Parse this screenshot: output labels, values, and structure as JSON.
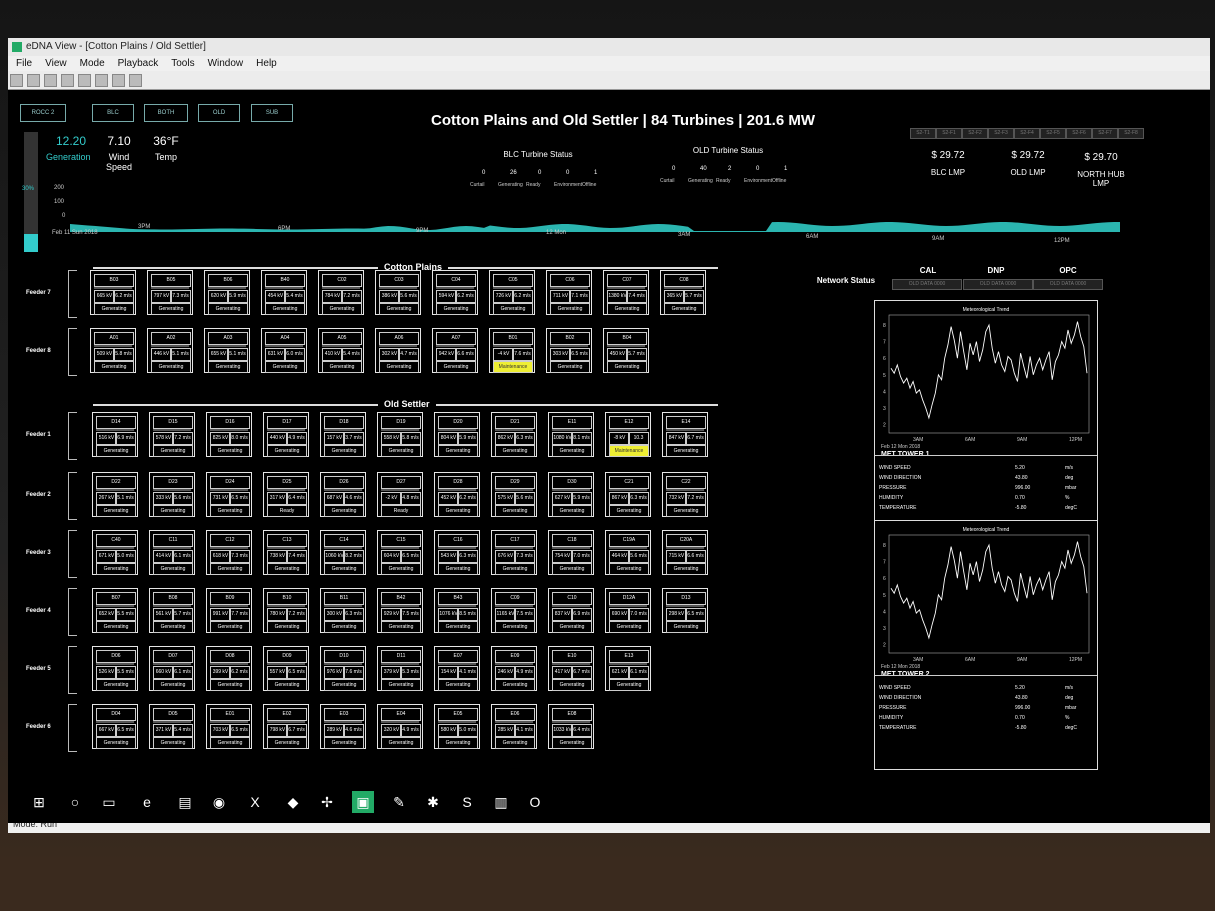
{
  "window": {
    "title": "eDNA View - [Cotton Plains / Old Settler]"
  },
  "menu": [
    "File",
    "View",
    "Mode",
    "Playback",
    "Tools",
    "Window",
    "Help"
  ],
  "statusbar": {
    "mode": "Mode: Run"
  },
  "nav": [
    "ROCC 2",
    "BLC",
    "BOTH",
    "OLD",
    "SUB"
  ],
  "header": {
    "title": "Cotton Plains and Old Settler | 84 Turbines | 201.6 MW",
    "generation": {
      "value": "12.20",
      "label": "Generation"
    },
    "wind": {
      "value": "7.10",
      "label": "Wind Speed"
    },
    "temp": {
      "value": "36°F",
      "label": "Temp"
    },
    "gauge_pct": "30%",
    "gauge_ticks": [
      "200",
      "100",
      "0"
    ],
    "gauge_fill_fraction": 0.15
  },
  "blc_status": {
    "title": "BLC Turbine Status",
    "counts": [
      "0",
      "26",
      "0",
      "0",
      "1"
    ],
    "labels": [
      "Curtail",
      "Generating",
      "Ready",
      "Environment",
      "Offline"
    ]
  },
  "old_status": {
    "title": "OLD Turbine Status",
    "counts": [
      "0",
      "40",
      "2",
      "0",
      "1"
    ],
    "labels": [
      "Curtail",
      "Generating",
      "Ready",
      "Environment",
      "Offline"
    ]
  },
  "lmp": {
    "tabs": [
      "S2-T1",
      "S2-F1",
      "S2-F2",
      "S2-F3",
      "S2-F4",
      "S2-F5",
      "S2-F6",
      "S2-F7",
      "S2-F8"
    ],
    "values": [
      {
        "price": "$ 29.72",
        "label": "BLC LMP"
      },
      {
        "price": "$ 29.72",
        "label": "OLD LMP"
      },
      {
        "price": "$ 29.70",
        "label": "NORTH HUB LMP"
      }
    ]
  },
  "timeline": {
    "ticks": [
      "3PM",
      "6PM",
      "9PM",
      "12 Mon",
      "3AM",
      "6AM",
      "9AM",
      "12PM"
    ],
    "date": "Feb 11 Sun 2018"
  },
  "sections": {
    "cotton": "Cotton Plains",
    "old": "Old Settler"
  },
  "network": {
    "label": "Network Status",
    "sites": [
      "CAL",
      "DNP",
      "OPC"
    ],
    "sub": [
      "OLD DATA 0000",
      "OLD DATA 0000",
      "OLD DATA 0000"
    ]
  },
  "feeders": [
    {
      "name": "Feeder 7",
      "turbines": [
        {
          "id": "B03",
          "kv": "665 kV",
          "ms": "6.2 m/s",
          "status": "Generating"
        },
        {
          "id": "B05",
          "kv": "797 kV",
          "ms": "7.3 m/s",
          "status": "Generating"
        },
        {
          "id": "B06",
          "kv": "620 kV",
          "ms": "5.9 m/s",
          "status": "Generating"
        },
        {
          "id": "B40",
          "kv": "454 kV",
          "ms": "5.4 m/s",
          "status": "Generating"
        },
        {
          "id": "C02",
          "kv": "784 kV",
          "ms": "7.2 m/s",
          "status": "Generating"
        },
        {
          "id": "C03",
          "kv": "386 kV",
          "ms": "5.6 m/s",
          "status": "Generating"
        },
        {
          "id": "C04",
          "kv": "594 kV",
          "ms": "6.2 m/s",
          "status": "Generating"
        },
        {
          "id": "C05",
          "kv": "726 kV",
          "ms": "6.2 m/s",
          "status": "Generating"
        },
        {
          "id": "C06",
          "kv": "711 kV",
          "ms": "7.1 m/s",
          "status": "Generating"
        },
        {
          "id": "C07",
          "kv": "1380 kV",
          "ms": "7.4 m/s",
          "status": "Generating"
        },
        {
          "id": "C08",
          "kv": "365 kV",
          "ms": "5.7 m/s",
          "status": "Generating"
        }
      ]
    },
    {
      "name": "Feeder 8",
      "turbines": [
        {
          "id": "A01",
          "kv": "509 kV",
          "ms": "5.8 m/s",
          "status": "Generating"
        },
        {
          "id": "A02",
          "kv": "446 kV",
          "ms": "5.1 m/s",
          "status": "Generating"
        },
        {
          "id": "A03",
          "kv": "655 kV",
          "ms": "5.1 m/s",
          "status": "Generating"
        },
        {
          "id": "A04",
          "kv": "631 kV",
          "ms": "6.0 m/s",
          "status": "Generating"
        },
        {
          "id": "A05",
          "kv": "410 kV",
          "ms": "5.4 m/s",
          "status": "Generating"
        },
        {
          "id": "A06",
          "kv": "302 kV",
          "ms": "4.7 m/s",
          "status": "Generating"
        },
        {
          "id": "A07",
          "kv": "942 kV",
          "ms": "6.6 m/s",
          "status": "Generating"
        },
        {
          "id": "B01",
          "kv": "-4 kV",
          "ms": "7.6 m/s",
          "status": "Maintenance"
        },
        {
          "id": "B02",
          "kv": "303 kV",
          "ms": "6.5 m/s",
          "status": "Generating"
        },
        {
          "id": "B04",
          "kv": "450 kV",
          "ms": "5.7 m/s",
          "status": "Generating"
        }
      ]
    },
    {
      "name": "Feeder 1",
      "turbines": [
        {
          "id": "D14",
          "kv": "516 kV",
          "ms": "6.9 m/s",
          "status": "Generating"
        },
        {
          "id": "D15",
          "kv": "578 kV",
          "ms": "7.2 m/s",
          "status": "Generating"
        },
        {
          "id": "D16",
          "kv": "825 kV",
          "ms": "8.0 m/s",
          "status": "Generating"
        },
        {
          "id": "D17",
          "kv": "440 kV",
          "ms": "4.9 m/s",
          "status": "Generating"
        },
        {
          "id": "D18",
          "kv": "157 kV",
          "ms": "3.7 m/s",
          "status": "Generating"
        },
        {
          "id": "D19",
          "kv": "558 kV",
          "ms": "5.8 m/s",
          "status": "Generating"
        },
        {
          "id": "D20",
          "kv": "804 kV",
          "ms": "5.9 m/s",
          "status": "Generating"
        },
        {
          "id": "D21",
          "kv": "862 kV",
          "ms": "6.3 m/s",
          "status": "Generating"
        },
        {
          "id": "E11",
          "kv": "1080 kV",
          "ms": "8.1 m/s",
          "status": "Generating"
        },
        {
          "id": "E12",
          "kv": "-8 kV",
          "ms": "10.3 m/s",
          "status": "Maintenance"
        },
        {
          "id": "E14",
          "kv": "847 kV",
          "ms": "6.7 m/s",
          "status": "Generating"
        }
      ]
    },
    {
      "name": "Feeder 2",
      "turbines": [
        {
          "id": "D22",
          "kv": "267 kV",
          "ms": "5.1 m/s",
          "status": "Generating"
        },
        {
          "id": "D23",
          "kv": "333 kV",
          "ms": "5.6 m/s",
          "status": "Generating"
        },
        {
          "id": "D24",
          "kv": "731 kV",
          "ms": "6.5 m/s",
          "status": "Generating"
        },
        {
          "id": "D25",
          "kv": "317 kV",
          "ms": "6.4 m/s",
          "status": "Ready"
        },
        {
          "id": "D26",
          "kv": "687 kV",
          "ms": "4.6 m/s",
          "status": "Generating"
        },
        {
          "id": "D27",
          "kv": "-2 kV",
          "ms": "4.8 m/s",
          "status": "Ready"
        },
        {
          "id": "D28",
          "kv": "452 kV",
          "ms": "6.2 m/s",
          "status": "Generating"
        },
        {
          "id": "D29",
          "kv": "575 kV",
          "ms": "5.6 m/s",
          "status": "Generating"
        },
        {
          "id": "D30",
          "kv": "627 kV",
          "ms": "5.9 m/s",
          "status": "Generating"
        },
        {
          "id": "C21",
          "kv": "867 kV",
          "ms": "6.3 m/s",
          "status": "Generating"
        },
        {
          "id": "C22",
          "kv": "732 kV",
          "ms": "7.2 m/s",
          "status": "Generating"
        }
      ]
    },
    {
      "name": "Feeder 3",
      "turbines": [
        {
          "id": "C40",
          "kv": "671 kV",
          "ms": "5.0 m/s",
          "status": "Generating"
        },
        {
          "id": "C11",
          "kv": "414 kV",
          "ms": "6.1 m/s",
          "status": "Generating"
        },
        {
          "id": "C12",
          "kv": "618 kV",
          "ms": "7.3 m/s",
          "status": "Generating"
        },
        {
          "id": "C13",
          "kv": "738 kV",
          "ms": "7.4 m/s",
          "status": "Generating"
        },
        {
          "id": "C14",
          "kv": "1060 kV",
          "ms": "8.2 m/s",
          "status": "Generating"
        },
        {
          "id": "C15",
          "kv": "604 kV",
          "ms": "6.5 m/s",
          "status": "Generating"
        },
        {
          "id": "C16",
          "kv": "543 kV",
          "ms": "6.3 m/s",
          "status": "Generating"
        },
        {
          "id": "C17",
          "kv": "676 kV",
          "ms": "7.3 m/s",
          "status": "Generating"
        },
        {
          "id": "C18",
          "kv": "754 kV",
          "ms": "7.0 m/s",
          "status": "Generating"
        },
        {
          "id": "C19A",
          "kv": "464 kV",
          "ms": "5.6 m/s",
          "status": "Generating"
        },
        {
          "id": "C20A",
          "kv": "715 kV",
          "ms": "6.6 m/s",
          "status": "Generating"
        }
      ]
    },
    {
      "name": "Feeder 4",
      "turbines": [
        {
          "id": "B07",
          "kv": "652 kV",
          "ms": "5.5 m/s",
          "status": "Generating"
        },
        {
          "id": "B08",
          "kv": "561 kV",
          "ms": "5.7 m/s",
          "status": "Generating"
        },
        {
          "id": "B09",
          "kv": "991 kV",
          "ms": "7.7 m/s",
          "status": "Generating"
        },
        {
          "id": "B10",
          "kv": "780 kV",
          "ms": "7.2 m/s",
          "status": "Generating"
        },
        {
          "id": "B11",
          "kv": "300 kV",
          "ms": "6.3 m/s",
          "status": "Generating"
        },
        {
          "id": "B42",
          "kv": "929 kV",
          "ms": "7.5 m/s",
          "status": "Generating"
        },
        {
          "id": "B43",
          "kv": "1076 kV",
          "ms": "8.5 m/s",
          "status": "Generating"
        },
        {
          "id": "C09",
          "kv": "1165 kV",
          "ms": "7.5 m/s",
          "status": "Generating"
        },
        {
          "id": "C10",
          "kv": "837 kV",
          "ms": "6.9 m/s",
          "status": "Generating"
        },
        {
          "id": "D12A",
          "kv": "690 kV",
          "ms": "7.0 m/s",
          "status": "Generating"
        },
        {
          "id": "D13",
          "kv": "298 kV",
          "ms": "6.5 m/s",
          "status": "Generating"
        }
      ]
    },
    {
      "name": "Feeder 5",
      "turbines": [
        {
          "id": "D06",
          "kv": "526 kV",
          "ms": "5.5 m/s",
          "status": "Generating"
        },
        {
          "id": "D07",
          "kv": "660 kV",
          "ms": "6.1 m/s",
          "status": "Generating"
        },
        {
          "id": "D08",
          "kv": "399 kV",
          "ms": "6.2 m/s",
          "status": "Generating"
        },
        {
          "id": "D09",
          "kv": "557 kV",
          "ms": "6.5 m/s",
          "status": "Generating"
        },
        {
          "id": "D10",
          "kv": "976 kV",
          "ms": "7.6 m/s",
          "status": "Generating"
        },
        {
          "id": "D11",
          "kv": "379 kV",
          "ms": "5.3 m/s",
          "status": "Generating"
        },
        {
          "id": "E07",
          "kv": "154 kV",
          "ms": "4.1 m/s",
          "status": "Generating"
        },
        {
          "id": "E09",
          "kv": "246 kV",
          "ms": "4.9 m/s",
          "status": "Generating"
        },
        {
          "id": "E10",
          "kv": "417 kV",
          "ms": "6.7 m/s",
          "status": "Generating"
        },
        {
          "id": "E13",
          "kv": "621 kV",
          "ms": "6.1 m/s",
          "status": "Generating"
        }
      ]
    },
    {
      "name": "Feeder 6",
      "turbines": [
        {
          "id": "D04",
          "kv": "667 kV",
          "ms": "6.5 m/s",
          "status": "Generating"
        },
        {
          "id": "D05",
          "kv": "371 kV",
          "ms": "5.4 m/s",
          "status": "Generating"
        },
        {
          "id": "E01",
          "kv": "703 kV",
          "ms": "6.5 m/s",
          "status": "Generating"
        },
        {
          "id": "E02",
          "kv": "798 kV",
          "ms": "6.7 m/s",
          "status": "Generating"
        },
        {
          "id": "E03",
          "kv": "289 kV",
          "ms": "4.6 m/s",
          "status": "Generating"
        },
        {
          "id": "E04",
          "kv": "320 kV",
          "ms": "4.9 m/s",
          "status": "Generating"
        },
        {
          "id": "E05",
          "kv": "580 kV",
          "ms": "5.0 m/s",
          "status": "Generating"
        },
        {
          "id": "E06",
          "kv": "285 kV",
          "ms": "4.1 m/s",
          "status": "Generating"
        },
        {
          "id": "E08",
          "kv": "1033 kV",
          "ms": "6.4 m/s",
          "status": "Generating"
        }
      ]
    }
  ],
  "met_towers": [
    {
      "name": "MET TOWER 1",
      "chart_title": "Meteorological Trend",
      "date": "Feb 12 Mon 2018",
      "x_ticks": [
        "3AM",
        "6AM",
        "9AM",
        "12PM"
      ],
      "y_ticks": [
        "8",
        "7",
        "6",
        "5",
        "4",
        "3",
        "2"
      ],
      "rows": [
        {
          "label": "WIND SPEED",
          "value": "5.20",
          "unit": "m/s"
        },
        {
          "label": "WIND DIRECTION",
          "value": "43.80",
          "unit": "deg"
        },
        {
          "label": "PRESSURE",
          "value": "996.00",
          "unit": "mbar"
        },
        {
          "label": "HUMIDITY",
          "value": "0.70",
          "unit": "%"
        },
        {
          "label": "TEMPERATURE",
          "value": "-5.80",
          "unit": "degC"
        }
      ]
    },
    {
      "name": "MET TOWER 2",
      "chart_title": "Meteorological Trend",
      "date": "Feb 12 Mon 2018",
      "x_ticks": [
        "3AM",
        "6AM",
        "9AM",
        "12PM"
      ],
      "y_ticks": [
        "8",
        "7",
        "6",
        "5",
        "4",
        "3",
        "2"
      ],
      "rows": [
        {
          "label": "WIND SPEED",
          "value": "5.20",
          "unit": "m/s"
        },
        {
          "label": "WIND DIRECTION",
          "value": "43.80",
          "unit": "deg"
        },
        {
          "label": "PRESSURE",
          "value": "996.00",
          "unit": "mbar"
        },
        {
          "label": "HUMIDITY",
          "value": "0.70",
          "unit": "%"
        },
        {
          "label": "TEMPERATURE",
          "value": "-5.80",
          "unit": "degC"
        }
      ]
    }
  ],
  "met_trend": [
    5.4,
    5.1,
    5.6,
    4.9,
    4.5,
    4.8,
    4.2,
    4.6,
    3.9,
    4.1,
    3.5,
    3.0,
    2.4,
    3.2,
    3.9,
    5.0,
    4.7,
    6.0,
    6.8,
    7.9,
    7.1,
    6.0,
    7.6,
    6.4,
    5.3,
    6.9,
    6.2,
    7.0,
    5.8,
    6.5,
    7.6,
    8.0,
    6.6,
    5.7,
    6.4,
    5.6,
    5.2,
    6.1,
    5.9,
    5.1,
    4.6,
    6.3,
    5.5,
    4.8,
    6.1,
    5.0,
    5.6,
    6.0,
    5.3,
    5.9,
    6.4,
    4.7,
    5.8,
    6.2,
    7.0,
    6.6,
    7.7,
    6.9,
    7.4,
    8.2,
    7.3,
    6.7,
    5.1
  ],
  "trend_colors": {
    "fill": "#2bb5b0",
    "line": "#ffffff",
    "accent": "#33cccc",
    "maint": "#eeee33"
  },
  "taskbar": {
    "icons": [
      "windows-icon",
      "search-icon",
      "task-view-icon",
      "edge-icon",
      "explorer-icon",
      "chrome-icon",
      "excel-icon",
      "app-icon",
      "turbine-icon",
      "edna-icon",
      "app2-icon",
      "app3-icon",
      "skype-icon",
      "notepad-icon",
      "outlook-icon"
    ]
  }
}
